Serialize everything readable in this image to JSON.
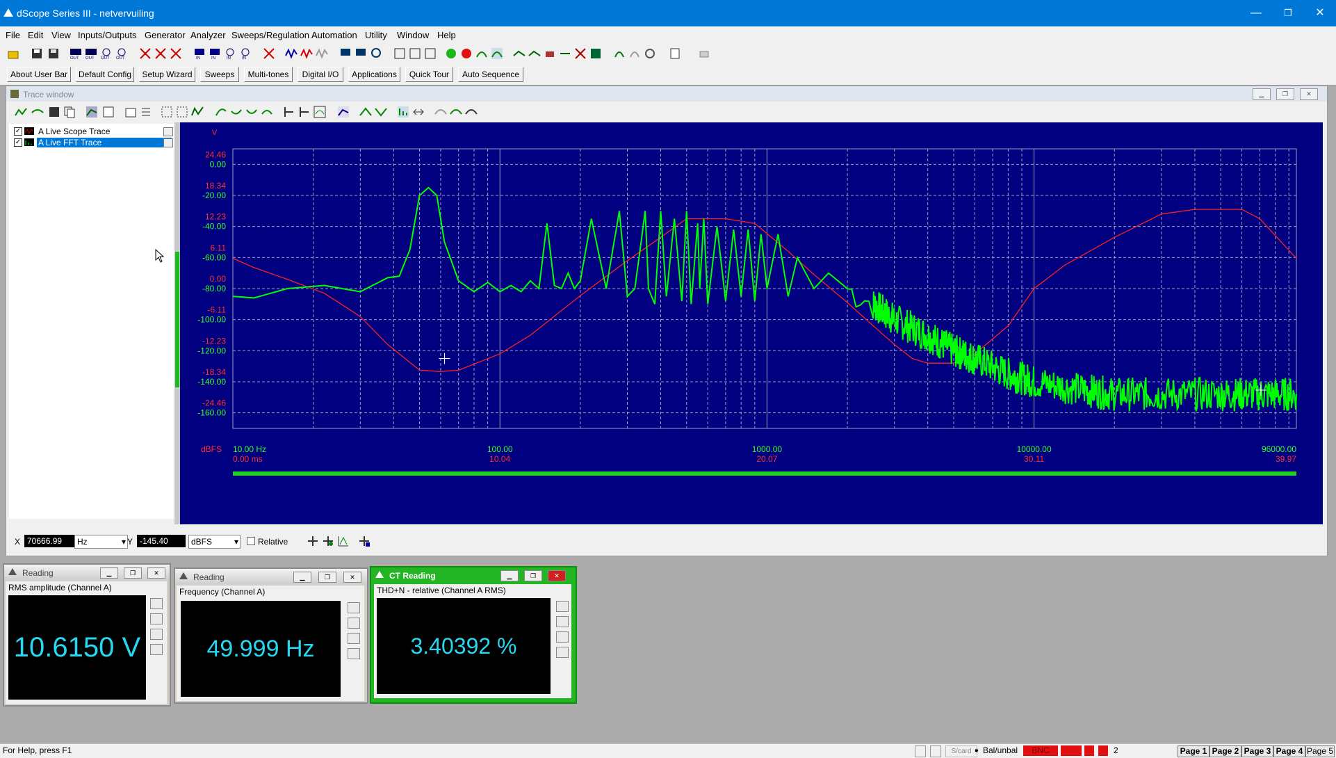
{
  "app": {
    "title": "dScope Series III - netvervuiling"
  },
  "window_controls": {
    "minimize": "—",
    "maximize": "❐",
    "close": "✕"
  },
  "menu": [
    "File",
    "Edit",
    "View",
    "Inputs/Outputs",
    "Generator",
    "Analyzer",
    "Sweeps/Regulation",
    "Automation",
    "Utility",
    "Window",
    "Help"
  ],
  "user_bar": [
    "About User Bar",
    "Default Config",
    "Setup Wizard",
    "Sweeps",
    "Multi-tones",
    "Digital I/O",
    "Applications",
    "Quick Tour",
    "Auto Sequence"
  ],
  "trace_window": {
    "title": "Trace window",
    "traces": [
      {
        "label": "A  Live Scope Trace",
        "checked": "✓",
        "selected": false
      },
      {
        "label": "A  Live FFT Trace",
        "checked": "✓",
        "selected": true
      }
    ]
  },
  "chart_data": {
    "type": "line",
    "y_unit_left_top": "V",
    "y_unit_left_bottom": "dBFS",
    "y_left_ticks_red": [
      "24.46",
      "18.34",
      "12.23",
      "6.11",
      "0.00",
      "-6.11",
      "-12.23",
      "-18.34",
      "-24.46"
    ],
    "y_left_ticks_green": [
      "0.00",
      "-20.00",
      "-40.00",
      "-60.00",
      "-80.00",
      "-100.00",
      "-120.00",
      "-140.00",
      "-160.00"
    ],
    "x_ticks_hz": [
      "10.00 Hz",
      "100.00",
      "1000.00",
      "10000.00",
      "96000.00"
    ],
    "x_ticks_ms": [
      "0.00 ms",
      "10.04",
      "20.07",
      "30.11",
      "39.97"
    ],
    "xscale": "log",
    "xlim_hz": [
      10,
      96000
    ],
    "ylim_dbfs": [
      -170,
      10
    ],
    "ylim_v": [
      -30,
      30
    ],
    "grid": true,
    "series": [
      {
        "color": "#00ff00",
        "x_hz": [
          10,
          12,
          16,
          22,
          30,
          38,
          42,
          46,
          50,
          54,
          58,
          62,
          70,
          80,
          90,
          100,
          110,
          120,
          130,
          140,
          150,
          160,
          170,
          180,
          190,
          200,
          220,
          250,
          280,
          300,
          320,
          350,
          360,
          380,
          400,
          420,
          450,
          480,
          500,
          520,
          550,
          560,
          580,
          600,
          650,
          700,
          750,
          800,
          850,
          900,
          950,
          1000,
          1100,
          1200,
          1300,
          1500,
          1700,
          2000,
          2500,
          3000,
          4000,
          5000,
          6000,
          8000,
          10000,
          15000,
          20000,
          30000,
          50000,
          70000,
          96000
        ],
        "y_dbfs": [
          -85,
          -86,
          -80,
          -78,
          -82,
          -73,
          -72,
          -55,
          -20,
          -15,
          -20,
          -50,
          -75,
          -82,
          -76,
          -82,
          -78,
          -82,
          -75,
          -80,
          -38,
          -78,
          -80,
          -70,
          -80,
          -75,
          -35,
          -80,
          -30,
          -85,
          -80,
          -30,
          -80,
          -90,
          -30,
          -85,
          -35,
          -88,
          -30,
          -90,
          -38,
          -80,
          -35,
          -90,
          -40,
          -88,
          -42,
          -85,
          -42,
          -88,
          -45,
          -80,
          -45,
          -85,
          -60,
          -80,
          -70,
          -80,
          -90,
          -100,
          -110,
          -120,
          -125,
          -135,
          -140,
          -145,
          -148,
          -148,
          -148,
          -148,
          -148
        ]
      },
      {
        "color": "#ff2020",
        "x_hz": [
          10,
          12,
          16,
          22,
          30,
          38,
          50,
          60,
          70,
          100,
          130,
          200,
          300,
          400,
          500,
          700,
          900,
          1200,
          1500,
          2000,
          2500,
          3000,
          3500,
          4000,
          5000,
          6000,
          8000,
          10000,
          13000,
          20000,
          30000,
          40000,
          50000,
          60000,
          70000,
          96000
        ],
        "v": [
          6.5,
          4.5,
          2,
          -1,
          -6,
          -12,
          -17.5,
          -17.8,
          -17.5,
          -14,
          -10,
          -1.5,
          6,
          11,
          15,
          15,
          14,
          8,
          3,
          -3,
          -8,
          -12,
          -15,
          -16,
          -16,
          -14,
          -8,
          0,
          5,
          11,
          16,
          17,
          17,
          17,
          15,
          6.5
        ]
      }
    ]
  },
  "cursor_bar": {
    "x_label": "X",
    "x_value": "70666.99",
    "x_unit": "Hz",
    "y_label": "Y",
    "y_value": "-145.40",
    "y_unit": "dBFS",
    "relative_label": "Relative"
  },
  "readings": [
    {
      "title": "Reading",
      "desc": "RMS amplitude (Channel A)",
      "value": "10.6150 V",
      "active": false
    },
    {
      "title": "Reading",
      "desc": "Frequency (Channel A)",
      "value": "49.999 Hz",
      "active": false
    },
    {
      "title": "CT Reading",
      "desc": "THD+N - relative (Channel A RMS)",
      "value": "3.40392 %",
      "active": true
    }
  ],
  "statusbar": {
    "help": "For Help, press F1",
    "sfcard": "S/card",
    "balunbal": "Bal/unbal",
    "bnc": "BNC",
    "count": "2",
    "pages": [
      "Page 1",
      "Page 2",
      "Page 3",
      "Page 4",
      "Page 5"
    ]
  }
}
